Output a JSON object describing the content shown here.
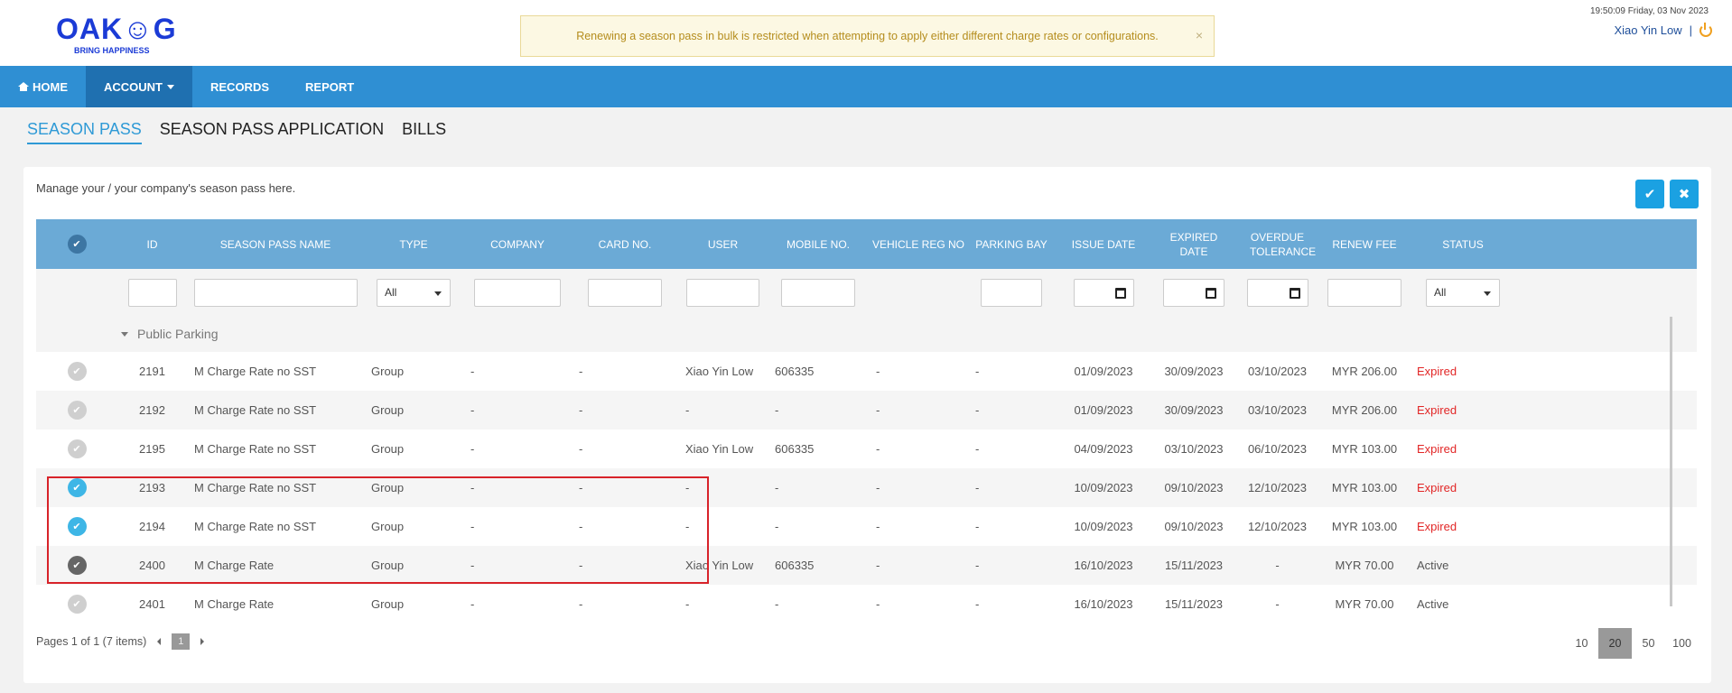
{
  "header": {
    "logo_text": "OAK☺G",
    "logo_tagline": "BRING HAPPINESS",
    "notice": "Renewing a season pass in bulk is restricted when attempting to apply either different charge rates or configurations.",
    "notice_close": "×",
    "clock": "19:50:09 Friday, 03 Nov 2023",
    "user_name": "Xiao Yin Low",
    "separator": "|"
  },
  "nav": {
    "items": [
      {
        "label": "HOME",
        "icon": "home-icon"
      },
      {
        "label": "ACCOUNT",
        "icon": "caret-down-icon",
        "active": true
      },
      {
        "label": "RECORDS"
      },
      {
        "label": "REPORT"
      }
    ]
  },
  "tabs": [
    {
      "label": "SEASON PASS",
      "active": true
    },
    {
      "label": "SEASON PASS APPLICATION"
    },
    {
      "label": "BILLS"
    }
  ],
  "panel": {
    "description": "Manage your / your company's season pass here.",
    "confirm_icon": "✔",
    "cancel_icon": "✖"
  },
  "columns": [
    "",
    "ID",
    "SEASON PASS NAME",
    "TYPE",
    "COMPANY",
    "CARD NO.",
    "USER",
    "MOBILE NO.",
    "VEHICLE REG NO",
    "PARKING BAY",
    "ISSUE DATE",
    "EXPIRED DATE",
    "OVERDUE TOLERANCE",
    "RENEW FEE",
    "STATUS"
  ],
  "filters": {
    "type_selected": "All",
    "status_selected": "All"
  },
  "group": {
    "label": "Public Parking"
  },
  "rows": [
    {
      "check": "off",
      "id": "2191",
      "name": "M Charge Rate no SST",
      "type": "Group",
      "company": "-",
      "card": "-",
      "user": "Xiao Yin Low",
      "mobile": "606335",
      "vehicle": "-",
      "bay": "-",
      "issue": "01/09/2023",
      "expired": "30/09/2023",
      "overdue": "03/10/2023",
      "fee": "MYR 206.00",
      "status": "Expired"
    },
    {
      "check": "off",
      "id": "2192",
      "name": "M Charge Rate no SST",
      "type": "Group",
      "company": "-",
      "card": "-",
      "user": "-",
      "mobile": "-",
      "vehicle": "-",
      "bay": "-",
      "issue": "01/09/2023",
      "expired": "30/09/2023",
      "overdue": "03/10/2023",
      "fee": "MYR 206.00",
      "status": "Expired"
    },
    {
      "check": "off",
      "id": "2195",
      "name": "M Charge Rate no SST",
      "type": "Group",
      "company": "-",
      "card": "-",
      "user": "Xiao Yin Low",
      "mobile": "606335",
      "vehicle": "-",
      "bay": "-",
      "issue": "04/09/2023",
      "expired": "03/10/2023",
      "overdue": "06/10/2023",
      "fee": "MYR 103.00",
      "status": "Expired"
    },
    {
      "check": "on",
      "id": "2193",
      "name": "M Charge Rate no SST",
      "type": "Group",
      "company": "-",
      "card": "-",
      "user": "-",
      "mobile": "-",
      "vehicle": "-",
      "bay": "-",
      "issue": "10/09/2023",
      "expired": "09/10/2023",
      "overdue": "12/10/2023",
      "fee": "MYR 103.00",
      "status": "Expired"
    },
    {
      "check": "on",
      "id": "2194",
      "name": "M Charge Rate no SST",
      "type": "Group",
      "company": "-",
      "card": "-",
      "user": "-",
      "mobile": "-",
      "vehicle": "-",
      "bay": "-",
      "issue": "10/09/2023",
      "expired": "09/10/2023",
      "overdue": "12/10/2023",
      "fee": "MYR 103.00",
      "status": "Expired"
    },
    {
      "check": "dark",
      "id": "2400",
      "name": "M Charge Rate",
      "type": "Group",
      "company": "-",
      "card": "-",
      "user": "Xiao Yin Low",
      "mobile": "606335",
      "vehicle": "-",
      "bay": "-",
      "issue": "16/10/2023",
      "expired": "15/11/2023",
      "overdue": "-",
      "fee": "MYR 70.00",
      "status": "Active"
    },
    {
      "check": "off",
      "id": "2401",
      "name": "M Charge Rate",
      "type": "Group",
      "company": "-",
      "card": "-",
      "user": "-",
      "mobile": "-",
      "vehicle": "-",
      "bay": "-",
      "issue": "16/10/2023",
      "expired": "15/11/2023",
      "overdue": "-",
      "fee": "MYR 70.00",
      "status": "Active"
    }
  ],
  "pager": {
    "summary": "Pages 1 of 1 (7 items)",
    "current": "1",
    "sizes": [
      "10",
      "20",
      "50",
      "100"
    ],
    "selected_size": "20"
  },
  "colors": {
    "navbar": "#2f8fd3",
    "grid_header": "#6baad6",
    "accent": "#1ba1e2",
    "expired": "#e22626",
    "highlight_box": "#d8232a"
  }
}
